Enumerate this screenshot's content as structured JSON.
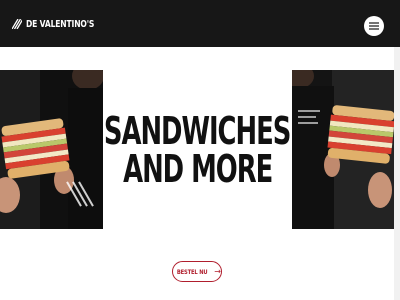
{
  "brand": {
    "name": "DE VALENTINO'S"
  },
  "header": {
    "menu_icon": "hamburger-menu-icon"
  },
  "hero": {
    "headline_line1": "SANDWICHES",
    "headline_line2": "AND MORE",
    "left_image": "person-holding-sandwich",
    "right_image": "person-holding-sandwich"
  },
  "cta": {
    "label": "BESTEL NU",
    "icon": "arrow-right-icon"
  },
  "colors": {
    "header_bg": "#171717",
    "accent": "#b01e2d",
    "text": "#111111"
  }
}
